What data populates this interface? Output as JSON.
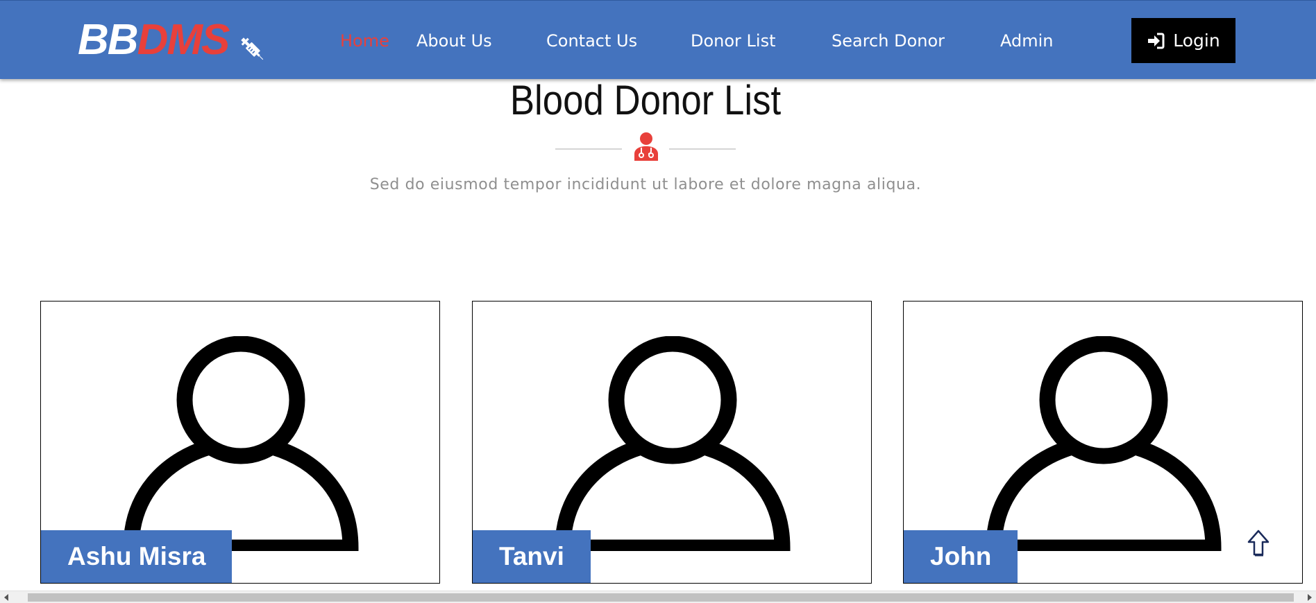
{
  "header": {
    "brand_part1": "BB",
    "brand_part2": "DMS",
    "brand_icon": "syringe-icon",
    "nav": [
      {
        "label": "Home",
        "active": true
      },
      {
        "label": "About Us"
      },
      {
        "label": "Contact Us"
      },
      {
        "label": "Donor List"
      },
      {
        "label": "Search Donor"
      },
      {
        "label": "Admin"
      }
    ],
    "login_label": "Login",
    "login_icon": "sign-in-icon",
    "colors": {
      "bar": "#4473be",
      "accent": "#e8403b",
      "button": "#000000"
    }
  },
  "main": {
    "title": "Blood Donor List",
    "title_icon": "user-doctor-icon",
    "subtitle": "Sed do eiusmod tempor incididunt ut labore et dolore magna aliqua.",
    "donors": [
      {
        "name": "Ashu Misra",
        "avatar": "user-placeholder-icon"
      },
      {
        "name": "Tanvi",
        "avatar": "user-placeholder-icon"
      },
      {
        "name": "John",
        "avatar": "user-placeholder-icon"
      }
    ]
  },
  "scroll_top_icon": "arrow-up-icon"
}
